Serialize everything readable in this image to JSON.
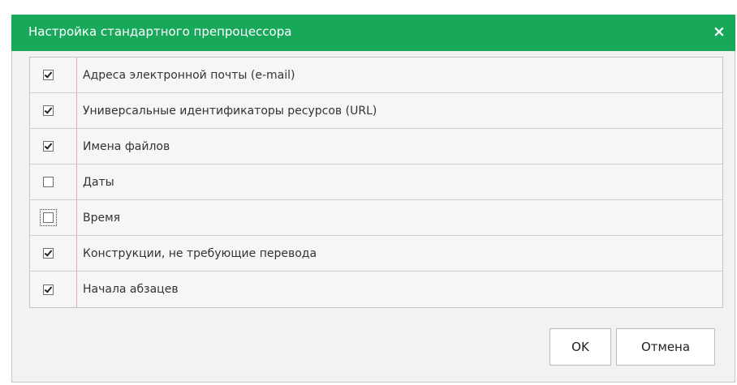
{
  "dialog": {
    "title": "Настройка стандартного препроцессора",
    "close_label": "×",
    "accent_color": "#17a85a"
  },
  "options": [
    {
      "label": "Адреса электронной почты (e-mail)",
      "checked": true
    },
    {
      "label": "Универсальные идентификаторы ресурсов (URL)",
      "checked": true
    },
    {
      "label": "Имена файлов",
      "checked": true
    },
    {
      "label": "Даты",
      "checked": false
    },
    {
      "label": "Время",
      "checked": false,
      "focused": true
    },
    {
      "label": "Конструкции, не требующие перевода",
      "checked": true
    },
    {
      "label": "Начала абзацев",
      "checked": true
    }
  ],
  "buttons": {
    "ok_label": "OK",
    "cancel_label": "Отмена"
  }
}
